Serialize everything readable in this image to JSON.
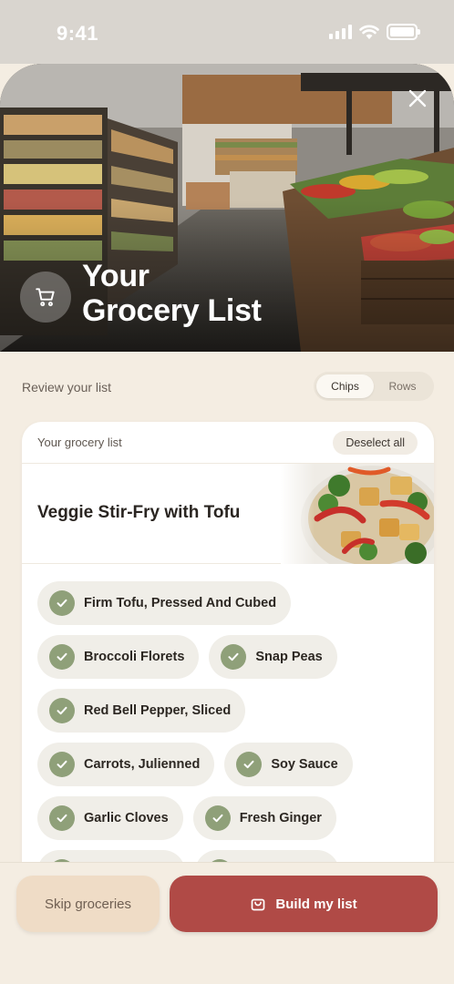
{
  "status_bar": {
    "time": "9:41"
  },
  "hero": {
    "title_line1": "Your",
    "title_line2": "Grocery List"
  },
  "review": {
    "label": "Review your list",
    "view_toggle": {
      "chips_label": "Chips",
      "rows_label": "Rows",
      "selected": "Chips"
    }
  },
  "card": {
    "header_label": "Your grocery list",
    "deselect_label": "Deselect all",
    "recipe_name": "Veggie Stir-Fry with Tofu",
    "ingredients": [
      {
        "name": "Firm Tofu, Pressed And Cubed",
        "checked": true
      },
      {
        "name": "Broccoli Florets",
        "checked": true
      },
      {
        "name": "Snap Peas",
        "checked": true
      },
      {
        "name": "Red Bell Pepper, Sliced",
        "checked": true
      },
      {
        "name": "Carrots, Julienned",
        "checked": true
      },
      {
        "name": "Soy Sauce",
        "checked": true
      },
      {
        "name": "Garlic Cloves",
        "checked": true
      },
      {
        "name": "Fresh Ginger",
        "checked": true
      }
    ]
  },
  "actions": {
    "skip_label": "Skip groceries",
    "build_label": "Build my list"
  },
  "colors": {
    "accent": "#b04a46",
    "check_green": "#8fa079",
    "background": "#f4ede2"
  }
}
